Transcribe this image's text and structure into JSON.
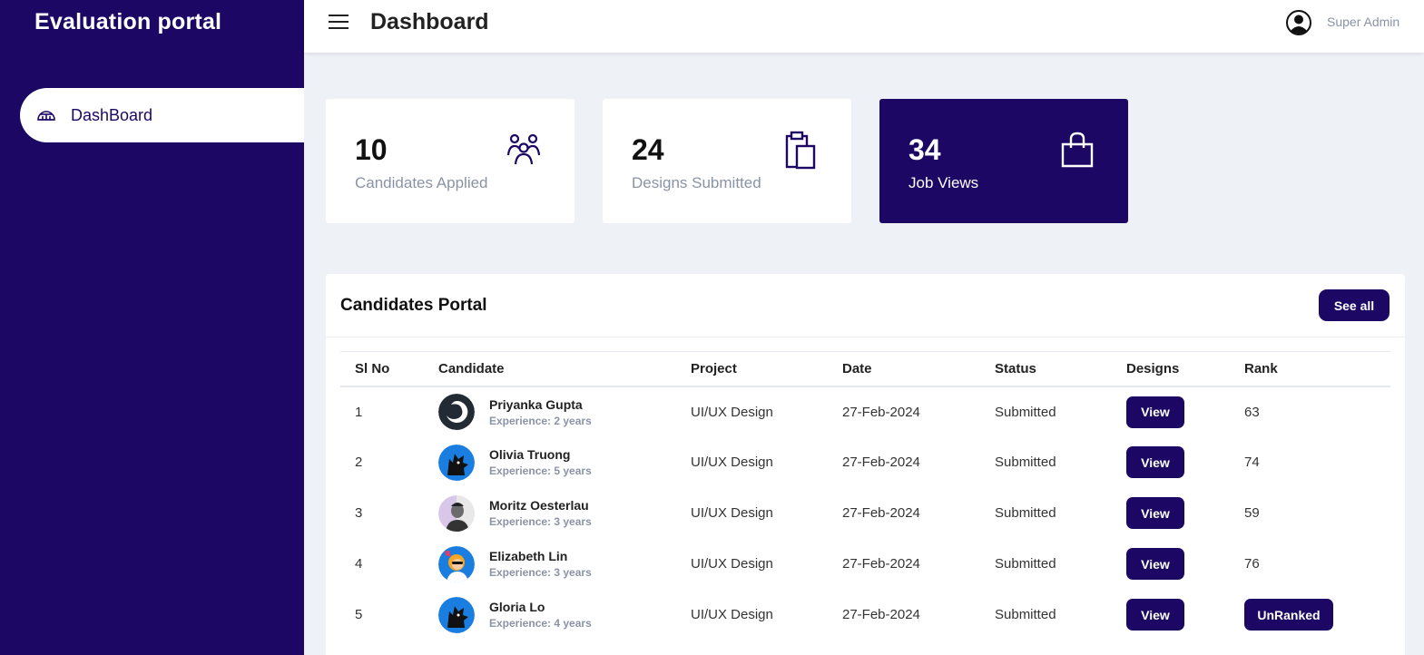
{
  "sidebar": {
    "brand": "Evaluation portal",
    "items": [
      {
        "label": "DashBoard",
        "icon": "dashboard-icon",
        "active": true
      }
    ]
  },
  "header": {
    "title": "Dashboard",
    "user": "Super Admin"
  },
  "stats": [
    {
      "value": "10",
      "label": "Candidates Applied",
      "icon": "users-group-icon"
    },
    {
      "value": "24",
      "label": "Designs Submitted",
      "icon": "clipboard-icon"
    },
    {
      "value": "34",
      "label": "Job Views",
      "icon": "shopping-bag-icon"
    }
  ],
  "panel": {
    "title": "Candidates Portal",
    "see_all": "See all",
    "columns": [
      "Sl No",
      "Candidate",
      "Project",
      "Date",
      "Status",
      "Designs",
      "Rank"
    ],
    "rows": [
      {
        "sl": "1",
        "name": "Priyanka Gupta",
        "experience": "Experience: 2 years",
        "project": "UI/UX Design",
        "date": "27-Feb-2024",
        "status": "Submitted",
        "design_action": "View",
        "rank": "63"
      },
      {
        "sl": "2",
        "name": "Olivia Truong",
        "experience": "Experience: 5 years",
        "project": "UI/UX Design",
        "date": "27-Feb-2024",
        "status": "Submitted",
        "design_action": "View",
        "rank": "74"
      },
      {
        "sl": "3",
        "name": "Moritz Oesterlau",
        "experience": "Experience: 3 years",
        "project": "UI/UX Design",
        "date": "27-Feb-2024",
        "status": "Submitted",
        "design_action": "View",
        "rank": "59"
      },
      {
        "sl": "4",
        "name": "Elizabeth Lin",
        "experience": "Experience: 3 years",
        "project": "UI/UX Design",
        "date": "27-Feb-2024",
        "status": "Submitted",
        "design_action": "View",
        "rank": "76"
      },
      {
        "sl": "5",
        "name": "Gloria Lo",
        "experience": "Experience: 4 years",
        "project": "UI/UX Design",
        "date": "27-Feb-2024",
        "status": "Submitted",
        "design_action": "View",
        "rank": "UnRanked"
      }
    ]
  },
  "colors": {
    "primary": "#1c0764",
    "background": "#eef2f6",
    "muted": "#8a93a6"
  }
}
